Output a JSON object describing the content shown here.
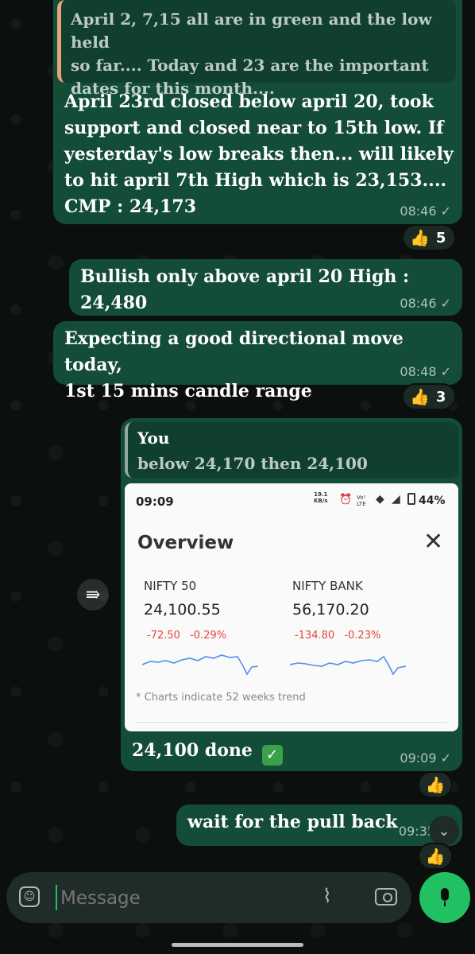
{
  "chat": {
    "quoted_top": {
      "text_line1": "April 2, 7,15 all are in green and the low held",
      "text_line2": "so far.... Today and 23 are the important",
      "text_line3": "dates for this month...."
    },
    "msg1": {
      "line1": "April 23rd closed below april 20, took",
      "line2": "support and closed near to 15th low. If",
      "line3": "yesterday's low breaks then... will likely",
      "line4": "to hit april 7th High which is 23,153....",
      "line5": "CMP : 24,173",
      "time": "08:46",
      "reaction_count": "5"
    },
    "msg2": {
      "text": "Bullish only above april 20 High : 24,480",
      "time": "08:46"
    },
    "msg3": {
      "line1": "Expecting a good directional move today,",
      "line2": "1st 15 mins candle range",
      "time": "08:48",
      "reaction_count": "3"
    },
    "msg4": {
      "quote_author": "You",
      "quote_text": "below 24,170 then 24,100",
      "caption": "24,100 done",
      "time": "09:09",
      "screenshot": {
        "status_time": "09:09",
        "status_speed": "19.1",
        "status_speed_unit": "KB/s",
        "status_net": "Vo¹ LTE",
        "battery": "44%",
        "title": "Overview",
        "nifty": {
          "name": "NIFTY 50",
          "value": "24,100.55",
          "change": "-72.50",
          "pct": "-0.29%"
        },
        "bank": {
          "name": "NIFTY BANK",
          "value": "56,170.20",
          "change": "-134.80",
          "pct": "-0.23%"
        },
        "footnote": "* Charts indicate 52 weeks trend"
      }
    },
    "msg5": {
      "text": "wait for the pull back",
      "time": "09:35"
    }
  },
  "composer": {
    "placeholder": "Message"
  },
  "colors": {
    "bubble": "#144d37",
    "accent": "#21c063",
    "down": "#e0453a",
    "spark": "#4f8ff0"
  }
}
